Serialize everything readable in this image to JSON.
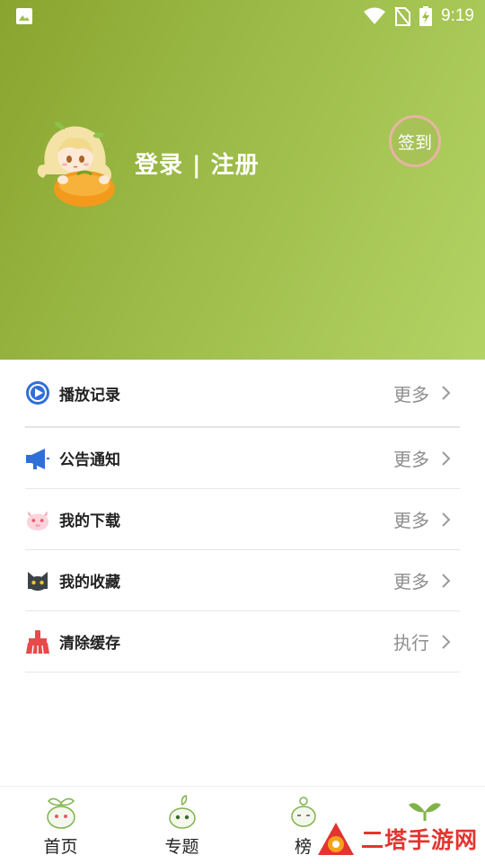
{
  "statusbar": {
    "time": "9:19"
  },
  "header": {
    "login_label": "登录 | 注册",
    "checkin_label": "签到"
  },
  "menu": [
    {
      "label": "播放记录",
      "action": "更多",
      "icon": "play-circle-icon",
      "color": "#2f6fd8"
    },
    {
      "label": "公告通知",
      "action": "更多",
      "icon": "megaphone-icon",
      "color": "#2f6fd8"
    },
    {
      "label": "我的下载",
      "action": "更多",
      "icon": "pink-creature-icon",
      "color": "#f1a7b5"
    },
    {
      "label": "我的收藏",
      "action": "更多",
      "icon": "cat-icon",
      "color": "#3c4346"
    },
    {
      "label": "清除缓存",
      "action": "执行",
      "icon": "broom-icon",
      "color": "#e84a4a"
    }
  ],
  "tabs": [
    {
      "label": "首页",
      "icon": "sprout-face-icon"
    },
    {
      "label": "专题",
      "icon": "sprout-face-icon"
    },
    {
      "label": "榜",
      "icon": "sprout-face-icon"
    },
    {
      "label": "",
      "icon": "sprout-icon"
    }
  ],
  "watermark": {
    "text": "二塔手游网"
  }
}
